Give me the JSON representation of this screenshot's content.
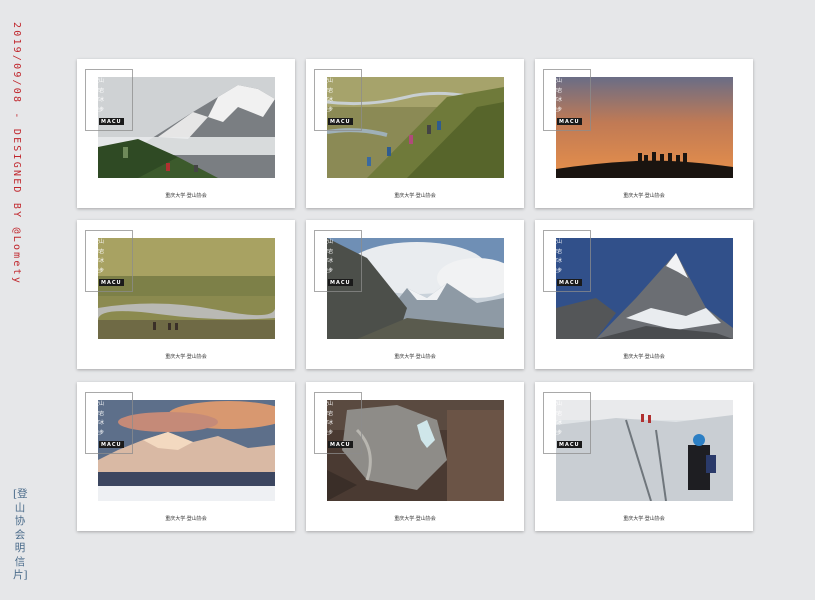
{
  "side_text": "2019/09/08 - DESIGNED BY @Lomety",
  "side_title": "[登山协会明信片]",
  "card": {
    "mottos": [
      "登山",
      "攀岩",
      "攀冰",
      "徒步"
    ],
    "brand": "MACU",
    "caption": "重庆大学·登山协会"
  },
  "cards": [
    {
      "photo": "snowy-peak-hikers"
    },
    {
      "photo": "grassy-slope-hikers"
    },
    {
      "photo": "sunset-silhouettes"
    },
    {
      "photo": "valley-riverbed"
    },
    {
      "photo": "cloudy-mountain-valley"
    },
    {
      "photo": "snow-pyramid-peak"
    },
    {
      "photo": "golden-range-sea-of-clouds"
    },
    {
      "photo": "ice-waterfall"
    },
    {
      "photo": "glacier-climbers"
    }
  ],
  "colors": {
    "accent": "#c0272d",
    "title": "#4a6b8a",
    "background": "#e6e7e9"
  }
}
